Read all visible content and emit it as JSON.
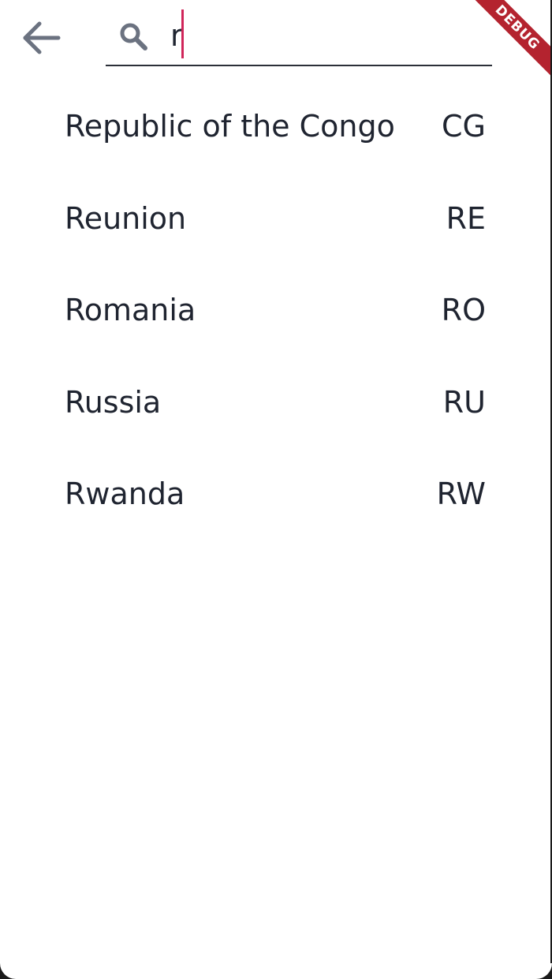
{
  "search": {
    "value": "r",
    "placeholder": ""
  },
  "header": {
    "back_icon": "arrow-back-icon",
    "search_icon": "search-icon"
  },
  "debug_banner": {
    "label": "DEBUG",
    "color": "#b4232f"
  },
  "colors": {
    "text": "#1f2430",
    "icon": "#6b7280",
    "caret": "#d0265a",
    "underline": "#2b2f38"
  },
  "countries": [
    {
      "name": "Republic of the Congo",
      "code": "CG"
    },
    {
      "name": "Reunion",
      "code": "RE"
    },
    {
      "name": "Romania",
      "code": "RO"
    },
    {
      "name": "Russia",
      "code": "RU"
    },
    {
      "name": "Rwanda",
      "code": "RW"
    }
  ]
}
